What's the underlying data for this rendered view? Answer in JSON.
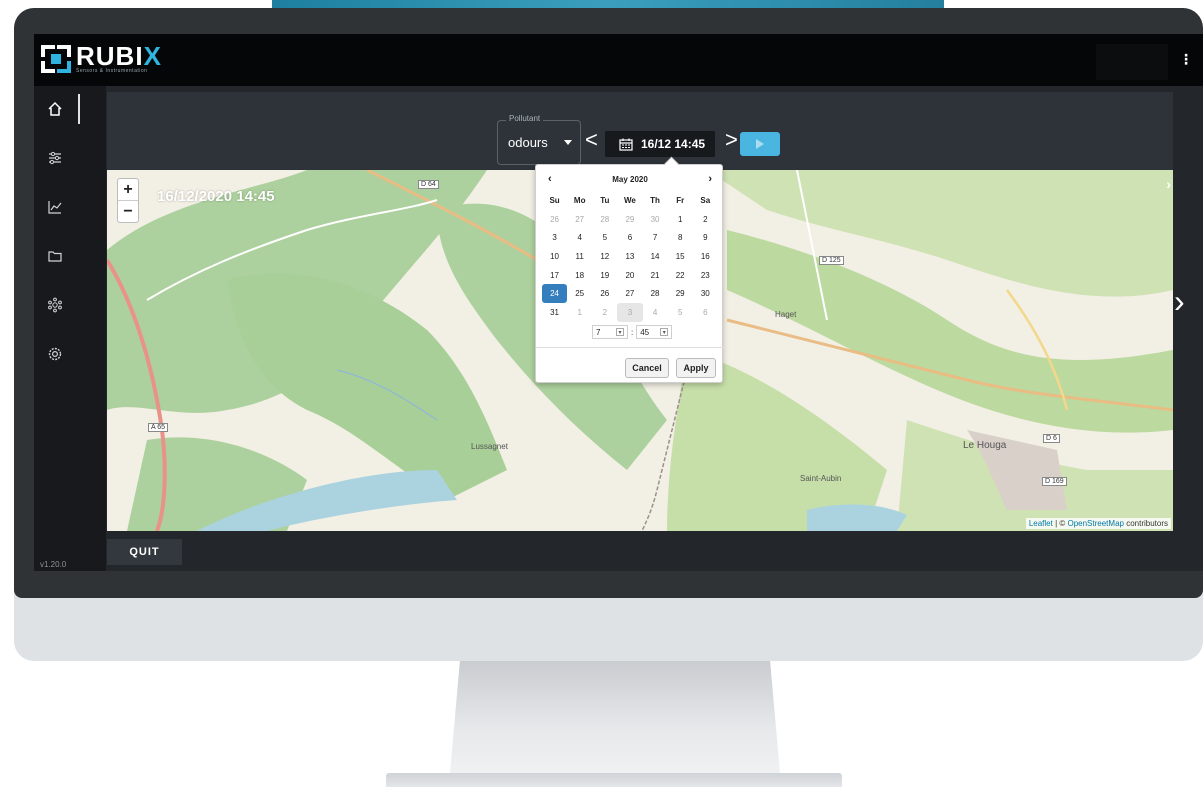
{
  "brand": {
    "name_main": "RUBI",
    "name_accent": "X",
    "tagline": "Sensors & Instrumentation"
  },
  "app": {
    "version": "v1.20.0"
  },
  "sidebar": {
    "items": [
      {
        "icon": "home-icon"
      },
      {
        "icon": "sliders-icon"
      },
      {
        "icon": "chart-icon"
      },
      {
        "icon": "folder-icon"
      },
      {
        "icon": "network-icon"
      },
      {
        "icon": "settings-icon"
      }
    ]
  },
  "controls": {
    "pollutant_label": "Pollutant",
    "pollutant_value": "odours",
    "date_value": "16/12 14:45",
    "prev_symbol": "<",
    "next_symbol": ">"
  },
  "map": {
    "timestamp": "16/12/2020 14:45",
    "zoom_in": "+",
    "zoom_out": "−",
    "places": [
      "Lussagnet",
      "Haget",
      "Saint-Aubin",
      "Le Houga"
    ],
    "roads": [
      "D 64",
      "D 125",
      "A 65",
      "D 6",
      "D 169"
    ],
    "attribution": {
      "leaflet": "Leaflet",
      "sep": " | © ",
      "osm": "OpenStreetMap",
      "suffix": " contributors"
    }
  },
  "footer": {
    "quit_label": "QUIT"
  },
  "datepicker": {
    "month_label": "May 2020",
    "weekdays": [
      "Su",
      "Mo",
      "Tu",
      "We",
      "Th",
      "Fr",
      "Sa"
    ],
    "weeks": [
      [
        "26",
        "27",
        "28",
        "29",
        "30",
        "1",
        "2"
      ],
      [
        "3",
        "4",
        "5",
        "6",
        "7",
        "8",
        "9"
      ],
      [
        "10",
        "11",
        "12",
        "13",
        "14",
        "15",
        "16"
      ],
      [
        "17",
        "18",
        "19",
        "20",
        "21",
        "22",
        "23"
      ],
      [
        "24",
        "25",
        "26",
        "27",
        "28",
        "29",
        "30"
      ],
      [
        "31",
        "1",
        "2",
        "3",
        "4",
        "5",
        "6"
      ]
    ],
    "selected_day": "24",
    "hour": "7",
    "minute": "45",
    "cancel_label": "Cancel",
    "apply_label": "Apply"
  },
  "colors": {
    "accent": "#2fb4e0",
    "selected_day": "#357ebd",
    "play_button": "#4bb5e1"
  }
}
